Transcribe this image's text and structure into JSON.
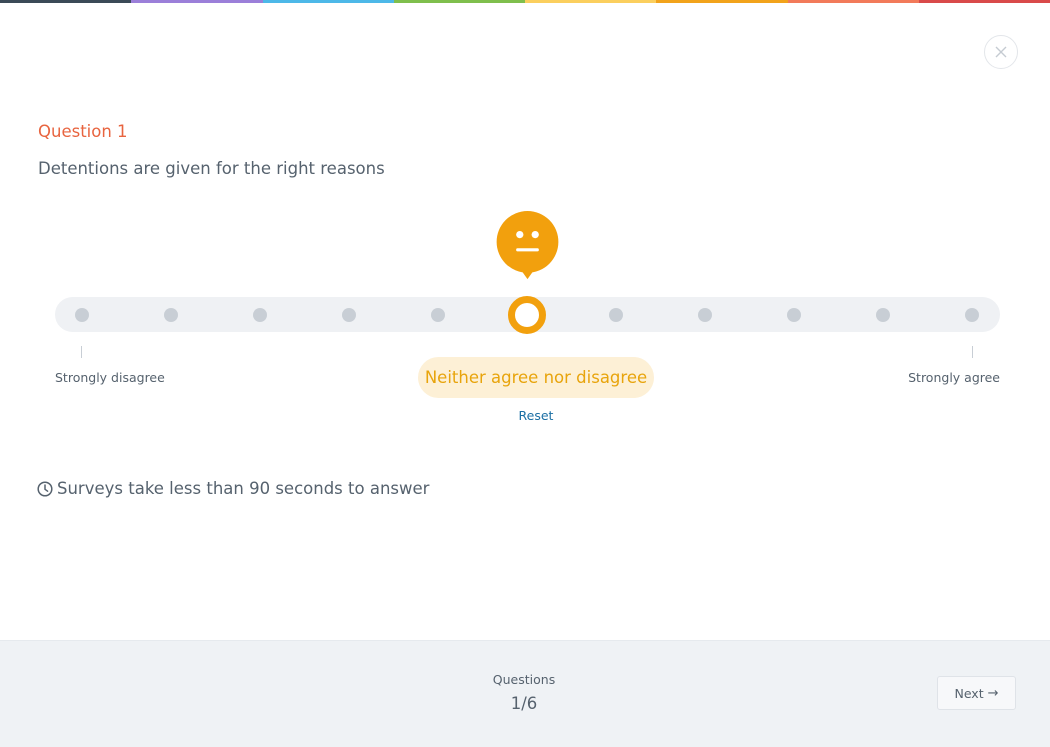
{
  "top_bar_colors": [
    "#3b4a57",
    "#9b7fd9",
    "#4db8e8",
    "#7fbf4d",
    "#fbcf5e",
    "#f2a31b",
    "#f27a5a",
    "#d94a4a"
  ],
  "close": {
    "icon": "close-icon",
    "label": "Close"
  },
  "question": {
    "label": "Question 1",
    "text": "Detentions are given for the right reasons"
  },
  "scale": {
    "points": 11,
    "selected_index": 5,
    "min_label": "Strongly disagree",
    "max_label": "Strongly agree",
    "selected_label": "Neither agree nor disagree",
    "selected_face": "neutral-face-icon",
    "accent_color": "#f2a00d",
    "reset_label": "Reset"
  },
  "info": {
    "icon": "clock-icon",
    "text": "Surveys take less than 90 seconds to answer"
  },
  "footer": {
    "progress_label": "Questions",
    "progress_value": "1/6",
    "next_label": "Next",
    "next_icon": "arrow-right-icon"
  }
}
